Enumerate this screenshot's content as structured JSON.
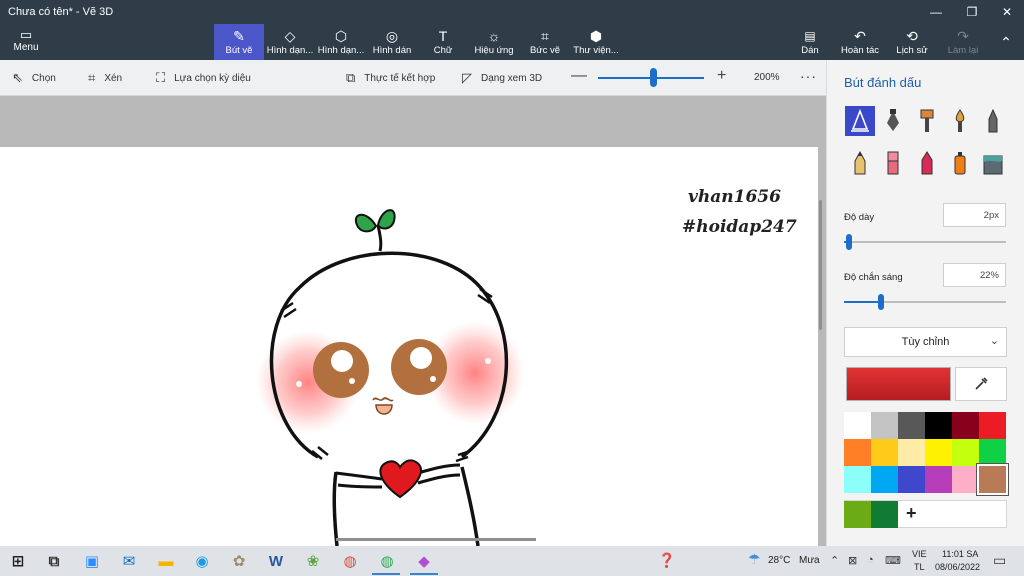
{
  "window": {
    "title": "Chưa có tên* - Vẽ 3D",
    "minimize_glyph": "—",
    "maximize_glyph": "❐",
    "close_glyph": "✕"
  },
  "ribbon": {
    "menu_label": "Menu",
    "tools": [
      {
        "label": "Bút vẽ",
        "icon": "brush-icon",
        "glyph": "✎"
      },
      {
        "label": "Hình dạn...",
        "icon": "2d-shapes-icon",
        "glyph": "◇"
      },
      {
        "label": "Hình dạn...",
        "icon": "3d-shapes-icon",
        "glyph": "⬡"
      },
      {
        "label": "Hình dán",
        "icon": "sticker-icon",
        "glyph": "◎"
      },
      {
        "label": "Chữ",
        "icon": "text-icon",
        "glyph": "T"
      },
      {
        "label": "Hiệu ứng",
        "icon": "effects-icon",
        "glyph": "☼"
      },
      {
        "label": "Bức vẽ",
        "icon": "canvas-icon",
        "glyph": "⌗"
      },
      {
        "label": "Thư viện...",
        "icon": "library-icon",
        "glyph": "⬢"
      }
    ],
    "right_tools": [
      {
        "label": "Dán",
        "icon": "paste-icon",
        "glyph": "📋"
      },
      {
        "label": "Hoàn tác",
        "icon": "undo-icon",
        "glyph": "↶"
      },
      {
        "label": "Lịch sử",
        "icon": "history-icon",
        "glyph": "⟲"
      },
      {
        "label": "Làm lại",
        "icon": "redo-icon",
        "glyph": "↷"
      }
    ],
    "collapse_glyph": "⌃"
  },
  "subtoolbar": {
    "select_label": "Chọn",
    "crop_label": "Xén",
    "magic_select_label": "Lựa chọn kỳ diệu",
    "mixed_reality_label": "Thực tế kết hợp",
    "view_3d_label": "Dạng xem 3D",
    "zoom_minus": "—",
    "zoom_plus": "+",
    "zoom_value": "200%",
    "zoom_level_fraction": 0.5,
    "more_glyph": "···"
  },
  "canvas": {
    "watermark_line1": "vhan1656",
    "watermark_line2": "#hoidap247"
  },
  "panel": {
    "title": "Bút đánh dấu",
    "brushes": [
      {
        "name": "marker",
        "color": "#3a49c9"
      },
      {
        "name": "calligraphy-pen",
        "color": "#444"
      },
      {
        "name": "oil-brush",
        "color": "#d8873b"
      },
      {
        "name": "watercolor",
        "color": "#e0a23a"
      },
      {
        "name": "pixel-pen",
        "color": "#555"
      },
      {
        "name": "pencil",
        "color": "#c9822e"
      },
      {
        "name": "eraser",
        "color": "#e86b7d"
      },
      {
        "name": "crayon",
        "color": "#d92a55"
      },
      {
        "name": "spray-can",
        "color": "#ef7d16"
      },
      {
        "name": "fill",
        "color": "#4aa39a"
      }
    ],
    "thickness_label": "Độ dày",
    "thickness_value": "2px",
    "thickness_fraction": 0.03,
    "opacity_label": "Độ chắn sáng",
    "opacity_value": "22%",
    "opacity_fraction": 0.22,
    "finish_dropdown": "Tùy chỉnh",
    "current_color": "#d42a2e",
    "palette": [
      "#ffffff",
      "#c3c3c3",
      "#585858",
      "#000000",
      "#88001b",
      "#ec1c24",
      "#ff7f27",
      "#ffca18",
      "#fdeca6",
      "#fff200",
      "#c4ff0e",
      "#0ed145",
      "#8cfffb",
      "#00a8f3",
      "#3f48cc",
      "#b83dba",
      "#ffaec8",
      "#b97a57"
    ],
    "custom_colors": [
      "#6aab16",
      "#107c33"
    ],
    "add_glyph": "+"
  },
  "taskbar": {
    "apps": [
      {
        "icon": "windows-start-icon",
        "glyph": "⊞",
        "color": "#1f1f1f"
      },
      {
        "icon": "task-view-icon",
        "glyph": "⧉",
        "color": "#333"
      },
      {
        "icon": "zoom-icon",
        "glyph": "▣",
        "color": "#2d8cff"
      },
      {
        "icon": "mail-icon",
        "glyph": "✉",
        "color": "#0f6cbd"
      },
      {
        "icon": "file-explorer-icon",
        "glyph": "▬",
        "color": "#f4b400"
      },
      {
        "icon": "edge-icon",
        "glyph": "◉",
        "color": "#1b9de2"
      },
      {
        "icon": "paint-icon",
        "glyph": "✿",
        "color": "#9c8d6b"
      },
      {
        "icon": "word-icon",
        "glyph": "W",
        "color": "#2b579a"
      },
      {
        "icon": "app-icon",
        "glyph": "❀",
        "color": "#5aa544"
      },
      {
        "icon": "chrome-icon",
        "glyph": "◍",
        "color": "#dd4b39"
      },
      {
        "icon": "chrome-profile-icon",
        "glyph": "◍",
        "color": "#34a853"
      },
      {
        "icon": "paint-3d-icon",
        "glyph": "◆",
        "color": "#b24fd6"
      }
    ],
    "weather_temp": "28°C",
    "weather_text": "Mưa",
    "lang_line1": "VIE",
    "lang_line2": "TL",
    "time": "11:01 SA",
    "date": "08/06/2022"
  }
}
